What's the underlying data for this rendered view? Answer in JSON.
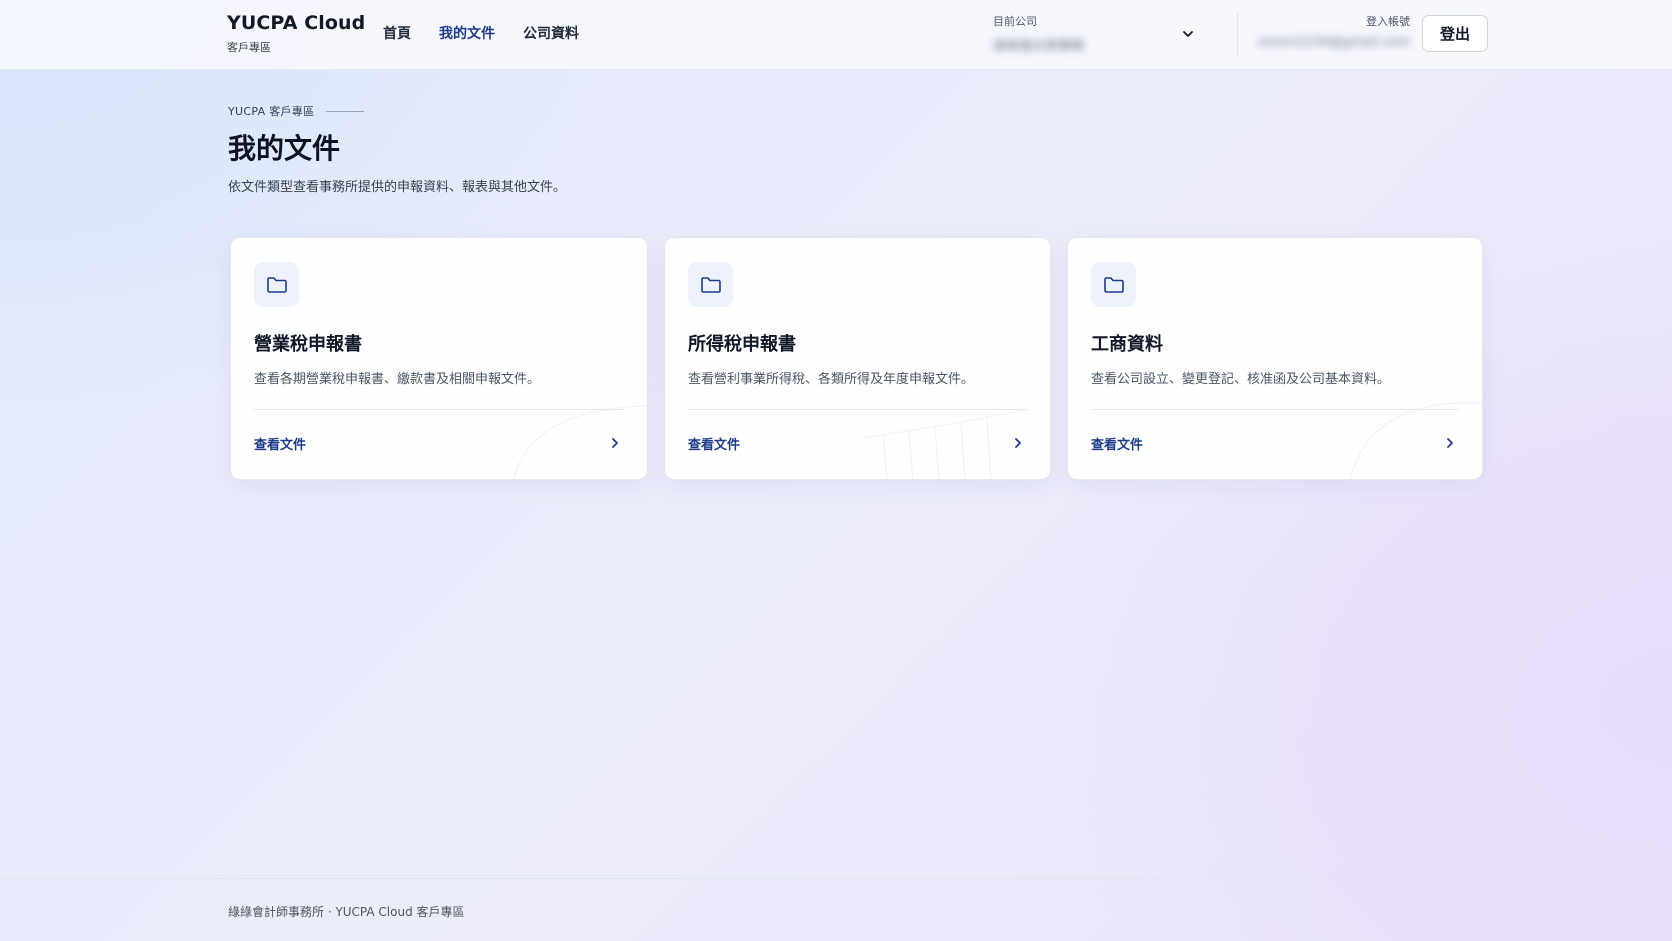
{
  "header": {
    "brand_title": "YUCPA Cloud",
    "brand_subtitle": "客戶專區",
    "nav": [
      {
        "label": "首頁",
        "active": false
      },
      {
        "label": "我的文件",
        "active": true
      },
      {
        "label": "公司資料",
        "active": false
      }
    ],
    "company_label": "目前公司",
    "company_value": "綠綠會計師事務",
    "account_label": "登入帳號",
    "account_value": "xxxxx1234@gmail.com",
    "logout_label": "登出"
  },
  "page": {
    "eyebrow": "YUCPA 客戶專區",
    "title": "我的文件",
    "description": "依文件類型查看事務所提供的申報資料、報表與其他文件。"
  },
  "cards": [
    {
      "title": "營業稅申報書",
      "description": "查看各期營業稅申報書、繳款書及相關申報文件。",
      "link_label": "查看文件",
      "icon": "folder-icon"
    },
    {
      "title": "所得稅申報書",
      "description": "查看營利事業所得稅、各類所得及年度申報文件。",
      "link_label": "查看文件",
      "icon": "folder-icon"
    },
    {
      "title": "工商資料",
      "description": "查看公司設立、變更登記、核准函及公司基本資料。",
      "link_label": "查看文件",
      "icon": "folder-icon"
    }
  ],
  "footer": {
    "text": "綠綠會計師事務所 · YUCPA Cloud 客戶專區"
  },
  "colors": {
    "accent": "#1e3a8a",
    "text": "#111827",
    "muted": "#4b5563",
    "icon_bg": "#eef2fb"
  }
}
